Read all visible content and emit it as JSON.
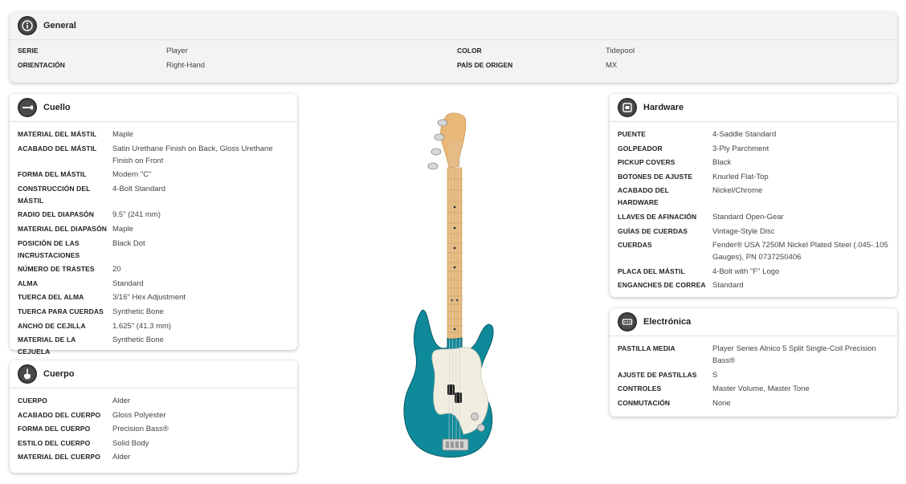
{
  "general": {
    "title": "General",
    "rows": [
      {
        "label": "SERIE",
        "value": "Player"
      },
      {
        "label": "COLOR",
        "value": "Tidepool"
      },
      {
        "label": "ORIENTACIÓN",
        "value": "Right-Hand"
      },
      {
        "label": "PAÍS DE ORIGEN",
        "value": "MX"
      }
    ]
  },
  "neck": {
    "title": "Cuello",
    "rows": [
      {
        "label": "MATERIAL DEL MÁSTIL",
        "value": "Maple"
      },
      {
        "label": "ACABADO DEL MÁSTIL",
        "value": "Satin Urethane Finish on Back, Gloss Urethane Finish on Front"
      },
      {
        "label": "FORMA DEL MÁSTIL",
        "value": "Modern \"C\""
      },
      {
        "label": "CONSTRUCCIÓN DEL MÁSTIL",
        "value": "4-Bolt Standard"
      },
      {
        "label": "RADIO DEL DIAPASÓN",
        "value": "9.5\" (241 mm)"
      },
      {
        "label": "MATERIAL DEL DIAPASÓN",
        "value": "Maple"
      },
      {
        "label": "POSICIÓN DE LAS INCRUSTACIONES",
        "value": "Black Dot"
      },
      {
        "label": "NÚMERO DE TRASTES",
        "value": "20"
      },
      {
        "label": "ALMA",
        "value": "Standard"
      },
      {
        "label": "TUERCA DEL ALMA",
        "value": "3/16\" Hex Adjustment"
      },
      {
        "label": "TUERCA PARA CUERDAS",
        "value": "Synthetic Bone"
      },
      {
        "label": "ANCHO DE CEJILLA",
        "value": "1.625\" (41.3 mm)"
      },
      {
        "label": "MATERIAL DE LA CEJUELA",
        "value": "Synthetic Bone"
      }
    ]
  },
  "body": {
    "title": "Cuerpo",
    "rows": [
      {
        "label": "CUERPO",
        "value": "Alder"
      },
      {
        "label": "ACABADO DEL CUERPO",
        "value": "Gloss Polyester"
      },
      {
        "label": "FORMA DEL CUERPO",
        "value": "Precision Bass®"
      },
      {
        "label": "ESTILO DEL CUERPO",
        "value": "Solid Body"
      },
      {
        "label": "MATERIAL DEL CUERPO",
        "value": "Alder"
      }
    ]
  },
  "hardware": {
    "title": "Hardware",
    "rows": [
      {
        "label": "PUENTE",
        "value": "4-Saddle Standard"
      },
      {
        "label": "GOLPEADOR",
        "value": "3-Ply Parchment"
      },
      {
        "label": "PICKUP COVERS",
        "value": "Black"
      },
      {
        "label": "BOTONES DE AJUSTE",
        "value": "Knurled Flat-Top"
      },
      {
        "label": "ACABADO DEL HARDWARE",
        "value": "Nickel/Chrome"
      },
      {
        "label": "LLAVES DE AFINACIÓN",
        "value": "Standard Open-Gear"
      },
      {
        "label": "GUÍAS DE CUERDAS",
        "value": "Vintage-Style Disc"
      },
      {
        "label": "CUERDAS",
        "value": "Fender® USA 7250M Nickel Plated Steel (.045-.105 Gauges), PN 0737250406"
      },
      {
        "label": "PLACA DEL MÁSTIL",
        "value": "4-Bolt with \"F\" Logo"
      },
      {
        "label": "ENGANCHES DE CORREA",
        "value": "Standard"
      }
    ]
  },
  "electronics": {
    "title": "Electrónica",
    "rows": [
      {
        "label": "PASTILLA MEDIA",
        "value": "Player Series Alnico 5 Split Single-Coil Precision Bass®"
      },
      {
        "label": "AJUSTE DE PASTILLAS",
        "value": "S"
      },
      {
        "label": "CONTROLES",
        "value": "Master Volume, Master Tone"
      },
      {
        "label": "CONMUTACIÓN",
        "value": "None"
      }
    ]
  },
  "guitar_image": {
    "icon": "precision-bass-guitar-image",
    "body_color": "#0f8a9a",
    "neck_color": "#e8b878"
  }
}
